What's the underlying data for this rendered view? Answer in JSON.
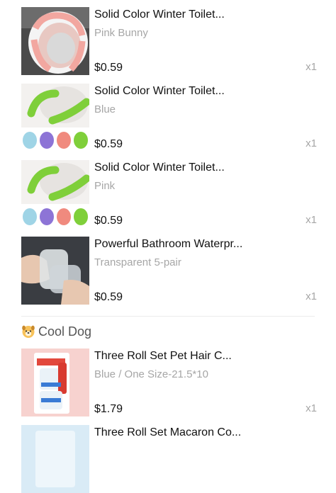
{
  "items": [
    {
      "title": "Solid Color Winter Toilet...",
      "variant": "Pink Bunny",
      "price": "$0.59",
      "quantity": "x1",
      "image_icon": "pink-toilet-seat-cover"
    },
    {
      "title": "Solid Color Winter Toilet...",
      "variant": "Blue",
      "price": "$0.59",
      "quantity": "x1",
      "image_icon": "green-toilet-seat-cover"
    },
    {
      "title": "Solid Color Winter Toilet...",
      "variant": "Pink",
      "price": "$0.59",
      "quantity": "x1",
      "image_icon": "green-toilet-seat-cover"
    },
    {
      "title": "Powerful Bathroom Waterpr...",
      "variant": "Transparent 5-pair",
      "price": "$0.59",
      "quantity": "x1",
      "image_icon": "transparent-pads"
    }
  ],
  "store": {
    "name": "Cool Dog",
    "icon": "dog-face-icon"
  },
  "store_items": [
    {
      "title": "Three Roll Set Pet Hair C...",
      "variant": "Blue / One Size-21.5*10",
      "price": "$1.79",
      "quantity": "x1",
      "image_icon": "lint-roller-set"
    },
    {
      "title": "Three Roll Set Macaron Co...",
      "variant": "",
      "price": "",
      "quantity": "",
      "image_icon": "lint-roller-set"
    }
  ],
  "colors": {
    "title_text": "#111111",
    "secondary_text": "#a6a6a6",
    "store_text": "#555555",
    "divider": "#ececec"
  }
}
